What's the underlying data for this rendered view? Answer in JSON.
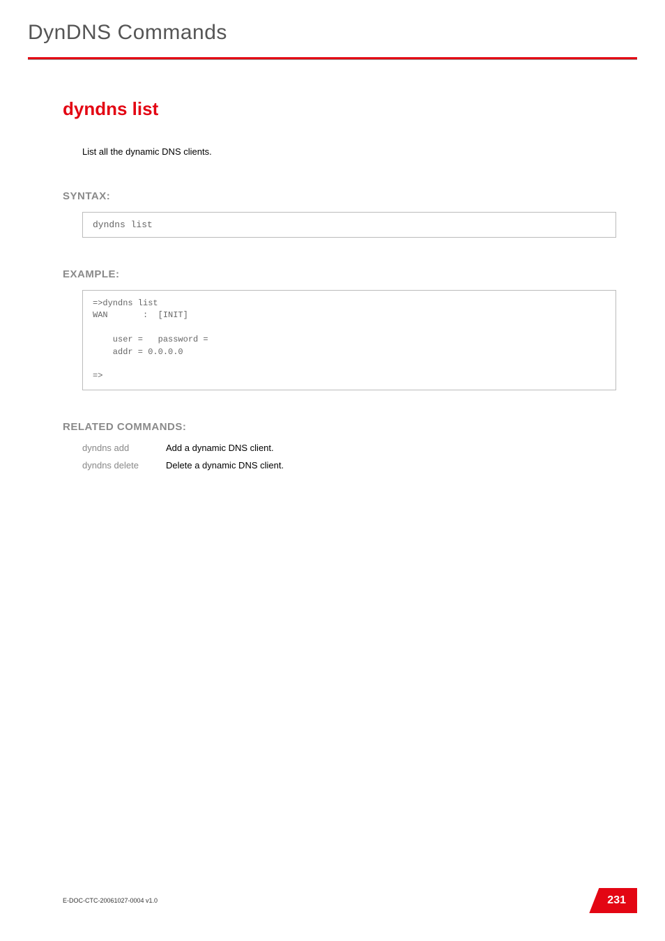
{
  "header": {
    "title": "DynDNS Commands"
  },
  "command": {
    "title": "dyndns list",
    "description": "List all the dynamic DNS clients."
  },
  "syntax": {
    "label": "SYNTAX:",
    "code": "dyndns list"
  },
  "example": {
    "label": "EXAMPLE:",
    "code": "=>dyndns list\nWAN       :  [INIT]\n\n    user =   password =\n    addr = 0.0.0.0\n\n=>"
  },
  "related": {
    "label": "RELATED COMMANDS:",
    "rows": [
      {
        "cmd": "dyndns add",
        "desc": "Add a dynamic DNS client."
      },
      {
        "cmd": "dyndns delete",
        "desc": "Delete a dynamic DNS client."
      }
    ]
  },
  "footer": {
    "doc": "E-DOC-CTC-20061027-0004 v1.0",
    "page": "231"
  }
}
